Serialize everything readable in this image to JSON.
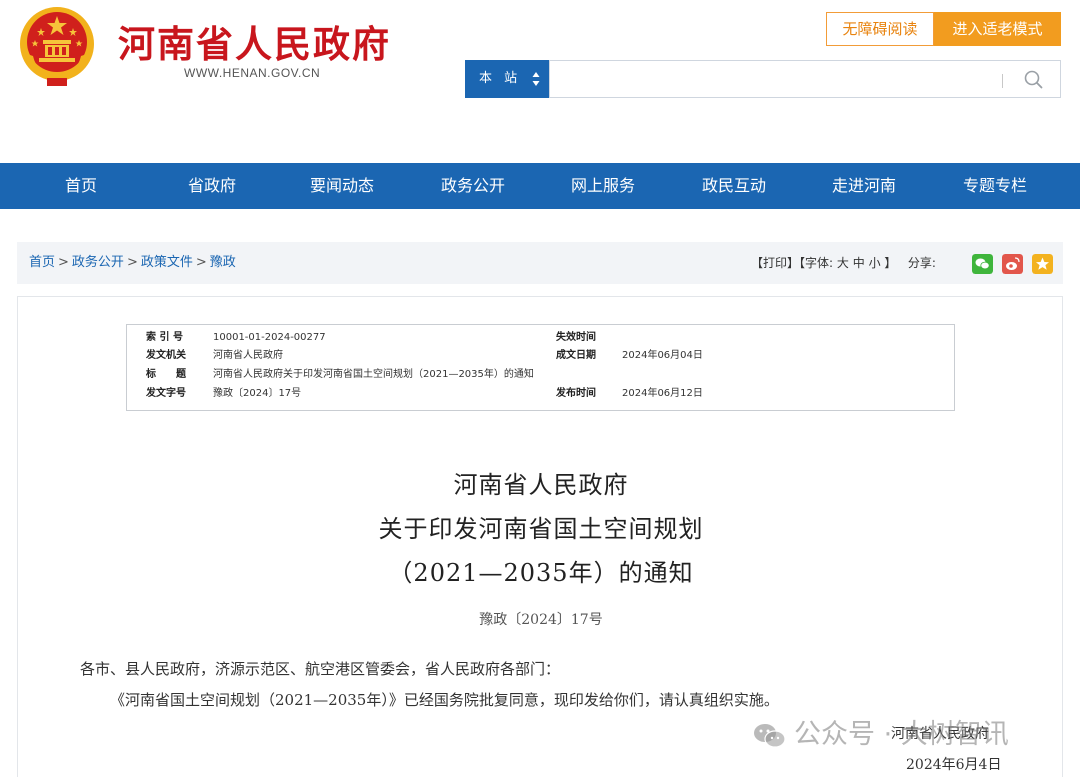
{
  "header": {
    "site_title": "河南省人民政府",
    "site_url": "WWW.HENAN.GOV.CN",
    "accessible_label": "无障碍阅读",
    "elder_mode_label": "进入适老模式",
    "search_scope": "本 站",
    "search_placeholder": ""
  },
  "nav": {
    "items": [
      "首页",
      "省政府",
      "要闻动态",
      "政务公开",
      "网上服务",
      "政民互动",
      "走进河南",
      "专题专栏"
    ]
  },
  "breadcrumb": {
    "items": [
      "首页",
      "政务公开",
      "政策文件",
      "豫政"
    ],
    "separator": ">"
  },
  "tools": {
    "print": "【打印】",
    "font_label": "【字体:",
    "font_large": "大",
    "font_medium": "中",
    "font_small": "小",
    "font_close": "】",
    "share_label": "分享:",
    "share_icons": [
      "wechat-icon",
      "weibo-icon",
      "favorite-icon"
    ]
  },
  "meta": {
    "index_label": "索 引 号",
    "index_value": "10001-01-2024-00277",
    "expire_label": "失效时间",
    "expire_value": "",
    "issuer_label": "发文机关",
    "issuer_value": "河南省人民政府",
    "created_label": "成文日期",
    "created_value": "2024年06月04日",
    "title_label": "标　　题",
    "title_value": "河南省人民政府关于印发河南省国土空间规划（2021—2035年）的通知",
    "docno_label": "发文字号",
    "docno_value": "豫政〔2024〕17号",
    "publish_label": "发布时间",
    "publish_value": "2024年06月12日"
  },
  "document": {
    "title_line1": "河南省人民政府",
    "title_line2": "关于印发河南省国土空间规划",
    "title_line3": "（2021—2035年）的通知",
    "doc_number": "豫政〔2024〕17号",
    "salutation": "各市、县人民政府，济源示范区、航空港区管委会，省人民政府各部门：",
    "body": "《河南省国土空间规划（2021—2035年）》已经国务院批复同意，现印发给你们，请认真组织实施。",
    "signature": "河南省人民政府",
    "date": "2024年6月4日"
  },
  "watermark": {
    "text": "公众号 · 大树智讯"
  },
  "colors": {
    "brand_red": "#c8161d",
    "nav_blue": "#1b66b2",
    "orange": "#f29c1f",
    "wechat_green": "#3fb53c",
    "weibo_red": "#e2564b",
    "star_yellow": "#f3b21f"
  }
}
